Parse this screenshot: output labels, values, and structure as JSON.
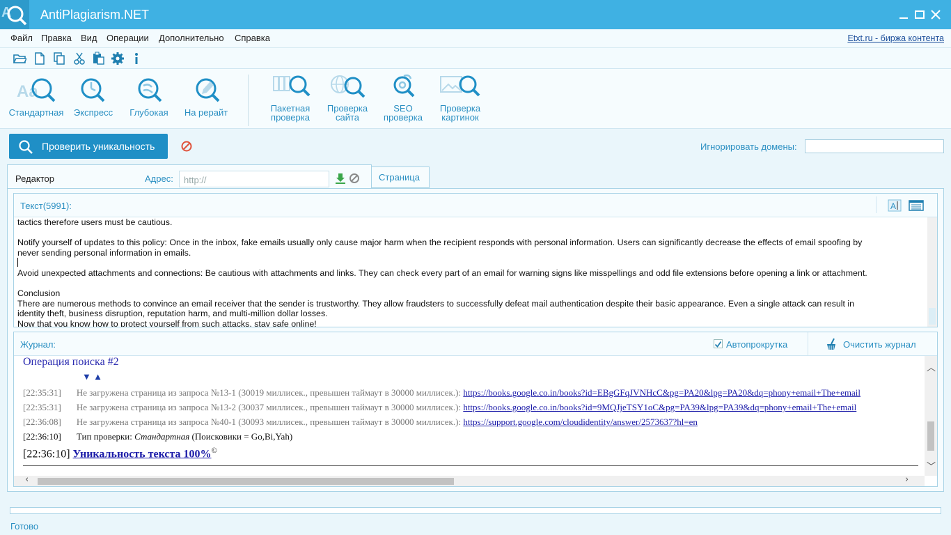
{
  "app": {
    "title": "AntiPlagiarism.NET"
  },
  "menu": {
    "items": [
      "Файл",
      "Правка",
      "Вид",
      "Операции",
      "Дополнительно",
      "Справка"
    ],
    "etxt_link": "Etxt.ru - биржа контента"
  },
  "big_toolbar": {
    "standard": "Стандартная",
    "express": "Экспресс",
    "deep": "Глубокая",
    "rewrite": "На рерайт",
    "batch_1": "Пакетная",
    "batch_2": "проверка",
    "site_1": "Проверка",
    "site_2": "сайта",
    "seo_1": "SEO",
    "seo_2": "проверка",
    "images_1": "Проверка",
    "images_2": "картинок"
  },
  "actions": {
    "check_label": "Проверить уникальность",
    "ignore_domains_label": "Игнорировать домены:",
    "ignore_domains_value": ""
  },
  "tabs": {
    "editor": "Редактор",
    "address_label": "Адрес:",
    "address_placeholder": "http://",
    "page": "Страница"
  },
  "text_panel": {
    "label": "Текст(5991):",
    "lines": [
      "tactics therefore users must be cautious.",
      "",
      "Notify yourself of updates to this policy: Once in the inbox, fake emails usually only cause major harm when the recipient responds with personal information. Users can significantly decrease the effects of email spoofing by",
      "never sending personal information in emails.",
      "",
      "Avoid unexpected attachments and connections: Be cautious with attachments and links. They can check every part of an email for warning signs like misspellings and odd file extensions before opening a link or attachment.",
      "",
      "Conclusion",
      "There are numerous methods to convince an email receiver that the sender is trustworthy. They allow fraudsters to successfully defeat mail authentication despite their basic appearance. Even a single attack can result in",
      "identity theft, business disruption, reputation harm, and multi-million dollar losses.",
      "Now that you know how to protect yourself from such attacks, stay safe online!"
    ]
  },
  "journal": {
    "label": "Журнал:",
    "autoscroll_label": "Автопрокрутка",
    "autoscroll_checked": true,
    "clear_label": "Очистить журнал",
    "operation_title": "Операция поиска #2",
    "arrows": "▼  ▲",
    "entries": [
      {
        "time": "[22:35:31]",
        "text": "Не загружена страница из запроса №13-1 (30019 миллисек., превышен таймаут в 30000 миллисек.):",
        "link": "https://books.google.co.in/books?id=EBgGFqJVNHcC&pg=PA20&lpg=PA20&dq=phony+email+The+email"
      },
      {
        "time": "[22:35:31]",
        "text": "Не загружена страница из запроса №13-2 (30037 миллисек., превышен таймаут в 30000 миллисек.):",
        "link": "https://books.google.co.in/books?id=9MQJjeTSY1oC&pg=PA39&lpg=PA39&dq=phony+email+The+email"
      },
      {
        "time": "[22:36:08]",
        "text": "Не загружена страница из запроса №40-1 (30093 миллисек., превышен таймаут в 30000 миллисек.):",
        "link": "https://support.google.com/cloudidentity/answer/2573637?hl=en"
      }
    ],
    "type_time": "[22:36:10]",
    "type_label": "Тип проверки:",
    "type_value": "Стандартная",
    "type_engines": "(Поисковики = Go,Bi,Yah)",
    "result_time": "[22:36:10]",
    "result_text": "Уникальность текста 100%",
    "result_sup": "©"
  },
  "status": {
    "text": "Готово"
  }
}
